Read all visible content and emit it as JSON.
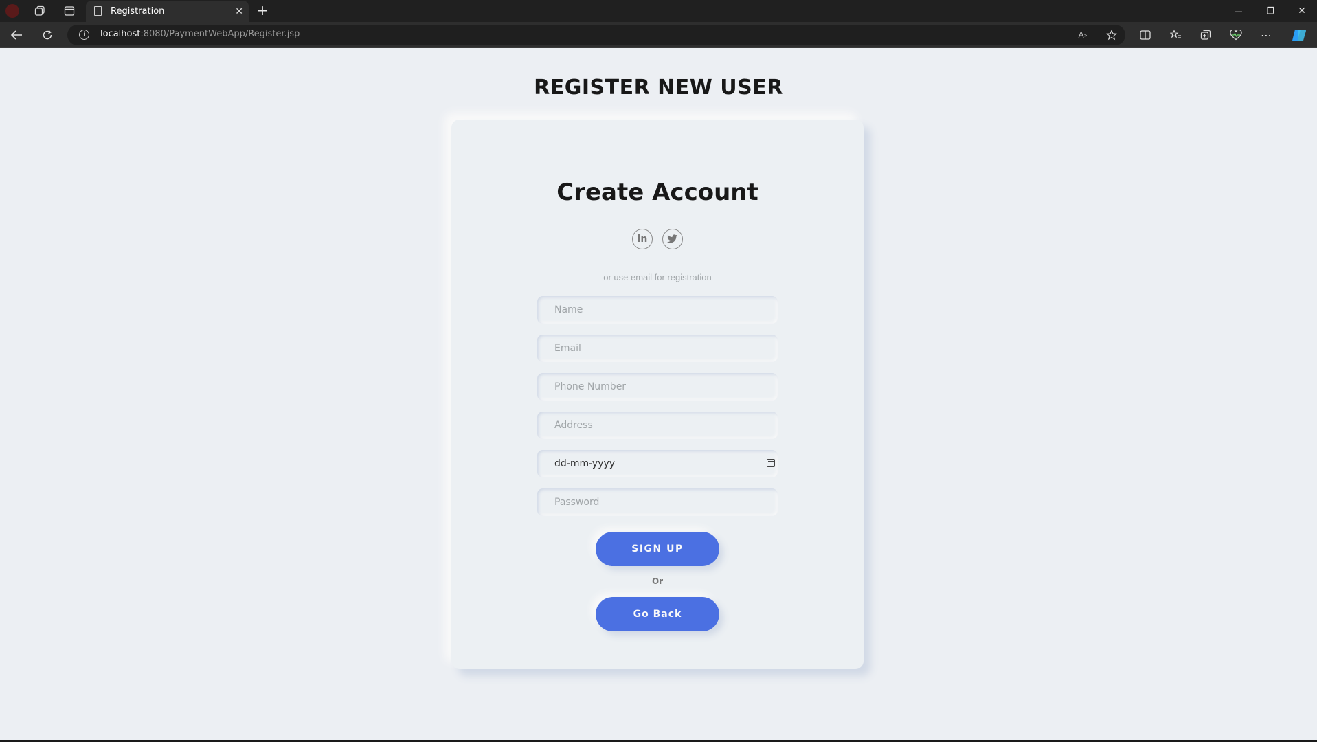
{
  "browser": {
    "tab_title": "Registration",
    "tab_close": "✕",
    "new_tab": "+",
    "url_host": "localhost",
    "url_path": ":8080/PaymentWebApp/Register.jsp",
    "window_minimize": "—",
    "window_restore": "❐",
    "window_close": "✕"
  },
  "page": {
    "heading": "REGISTER NEW USER"
  },
  "form": {
    "title": "Create Account",
    "social": [
      {
        "label": "in",
        "icon": "linkedin-icon"
      },
      {
        "label": "t",
        "icon": "twitter-icon"
      }
    ],
    "subtext": "or use email for registration",
    "fields": {
      "name_placeholder": "Name",
      "email_placeholder": "Email",
      "phone_placeholder": "Phone Number",
      "address_placeholder": "Address",
      "date_value": "dd-mm-yyyy",
      "password_placeholder": "Password"
    },
    "signup_label": "SIGN UP",
    "or_label": "Or",
    "goback_label": "Go Back",
    "accent_color": "#4b70e2"
  }
}
